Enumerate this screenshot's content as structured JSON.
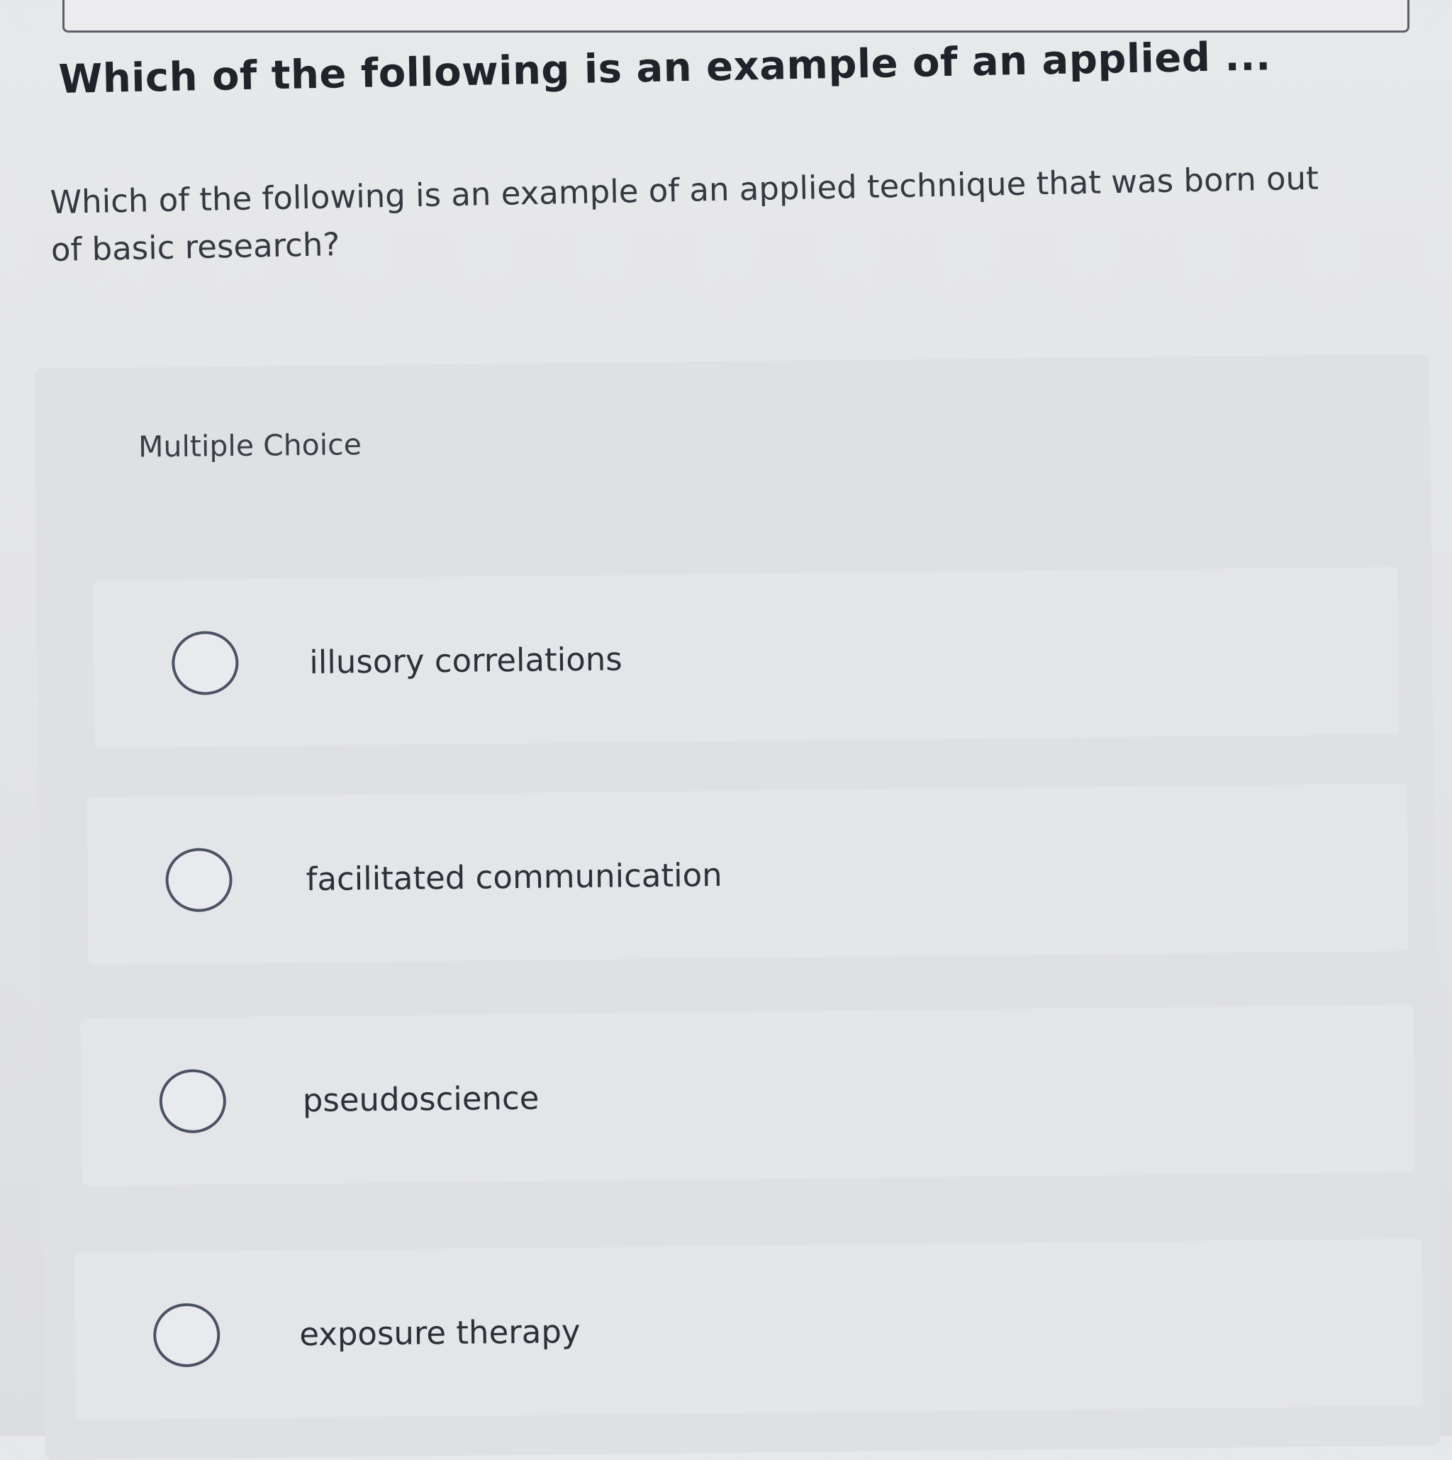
{
  "question": {
    "header": "Which of the following is an example of an applied ...",
    "body_line1": "Which of the following is an example of an applied technique that was born out",
    "body_line2": "of basic research?"
  },
  "choices_panel": {
    "title": "Multiple Choice",
    "options": [
      {
        "label": "illusory correlations",
        "selected": false
      },
      {
        "label": "facilitated communication",
        "selected": false
      },
      {
        "label": "pseudoscience",
        "selected": false
      },
      {
        "label": "exposure therapy",
        "selected": false
      }
    ]
  },
  "colors": {
    "background": "#e3e4e6",
    "text": "#2b2f36",
    "radio_border": "#4a5263"
  }
}
